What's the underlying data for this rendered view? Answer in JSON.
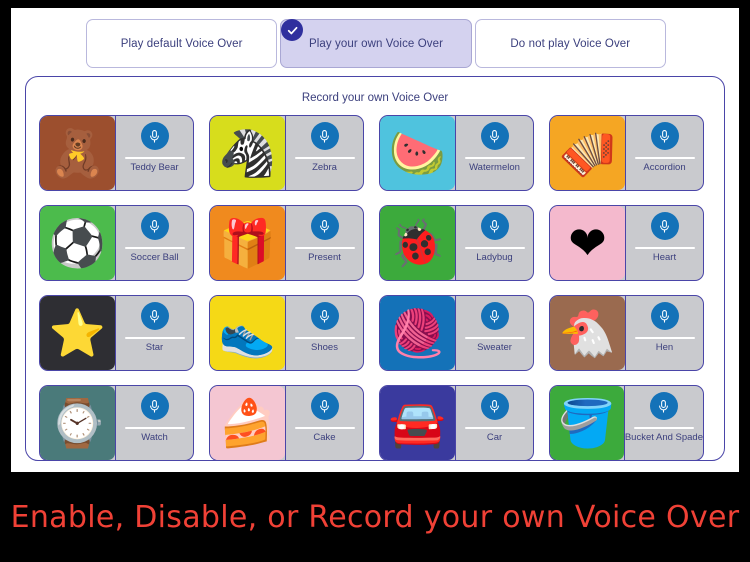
{
  "tabs": [
    {
      "label": "Play default Voice Over",
      "selected": false
    },
    {
      "label": "Play your own Voice Over",
      "selected": true
    },
    {
      "label": "Do not play Voice Over",
      "selected": false
    }
  ],
  "panel": {
    "title": "Record your own Voice Over",
    "mic_icon": "microphone-icon",
    "check_icon": "check-circle-icon"
  },
  "cards": [
    {
      "label": "Teddy Bear",
      "glyph": "🧸",
      "bg": "#9c4f2e"
    },
    {
      "label": "Zebra",
      "glyph": "🦓",
      "bg": "#d7dd1c"
    },
    {
      "label": "Watermelon",
      "glyph": "🍉",
      "bg": "#4fc3de"
    },
    {
      "label": "Accordion",
      "glyph": "🪗",
      "bg": "#f5a623"
    },
    {
      "label": "Soccer Ball",
      "glyph": "⚽",
      "bg": "#4cbb4c"
    },
    {
      "label": "Present",
      "glyph": "🎁",
      "bg": "#f08a1e"
    },
    {
      "label": "Ladybug",
      "glyph": "🐞",
      "bg": "#3caa3c"
    },
    {
      "label": "Heart",
      "glyph": "❤",
      "bg": "#f4b9cd"
    },
    {
      "label": "Star",
      "glyph": "⭐",
      "bg": "#2e2e33"
    },
    {
      "label": "Shoes",
      "glyph": "👟",
      "bg": "#f5d916"
    },
    {
      "label": "Sweater",
      "glyph": "🧶",
      "bg": "#1472b8"
    },
    {
      "label": "Hen",
      "glyph": "🐔",
      "bg": "#9a6a4f"
    },
    {
      "label": "Watch",
      "glyph": "⌚",
      "bg": "#4a7a7a"
    },
    {
      "label": "Cake",
      "glyph": "🍰",
      "bg": "#f4c6d2"
    },
    {
      "label": "Car",
      "glyph": "🚘",
      "bg": "#3a3a9e"
    },
    {
      "label": "Bucket And Spade",
      "glyph": "🪣",
      "bg": "#3caa3c"
    }
  ],
  "caption": {
    "text": "Enable, Disable, or Record your own Voice Over",
    "color": "#f04136"
  }
}
